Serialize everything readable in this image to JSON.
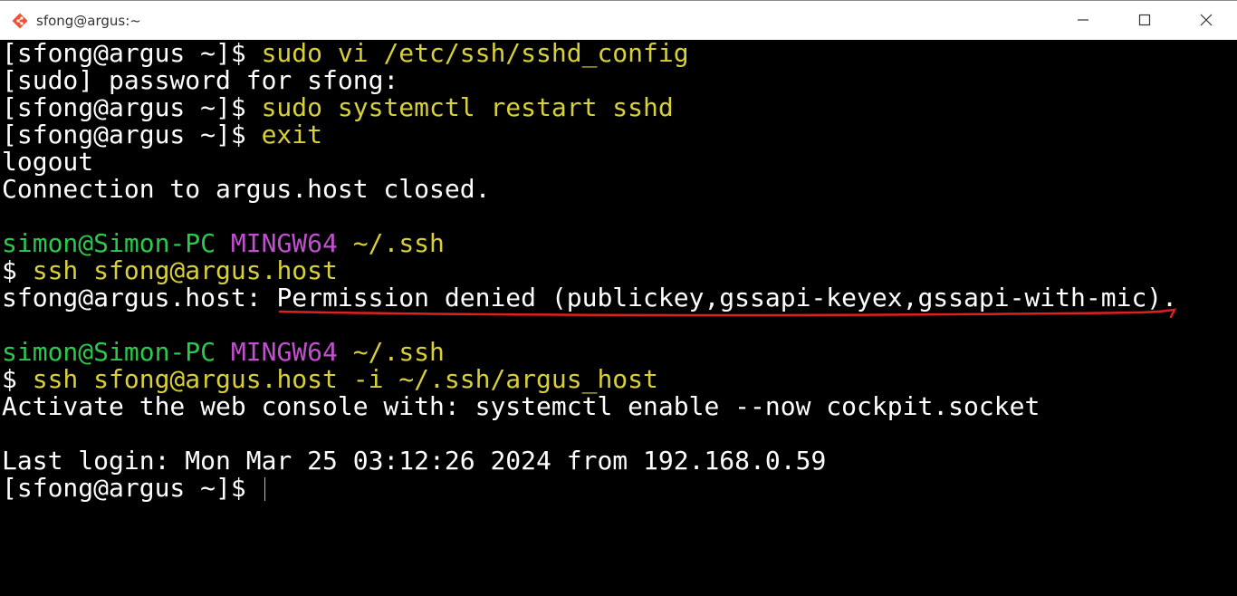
{
  "window": {
    "title": "sfong@argus:~",
    "icon": "git-diamond-icon",
    "controls": {
      "minimize": "minimize-icon",
      "maximize": "maximize-icon",
      "close": "close-icon"
    }
  },
  "colors": {
    "background": "#000000",
    "text": "#ffffff",
    "command": "#d8d03a",
    "user_host": "#2bc94d",
    "mingw": "#c24fd1",
    "annotation": "#e02020"
  },
  "terminal": {
    "l1_prompt": "[sfong@argus ~]$ ",
    "l1_cmd": "sudo vi /etc/ssh/sshd_config",
    "l2": "[sudo] password for sfong:",
    "l3_prompt": "[sfong@argus ~]$ ",
    "l3_cmd": "sudo systemctl restart sshd",
    "l4_prompt": "[sfong@argus ~]$ ",
    "l4_cmd": "exit",
    "l5": "logout",
    "l6": "Connection to argus.host closed.",
    "p1_user": "simon@Simon-PC",
    "p1_env": "MINGW64",
    "p1_path": "~/.ssh",
    "l8_dollar": "$ ",
    "l8_cmd": "ssh sfong@argus.host",
    "l9_prefix": "sfong@argus.host: ",
    "l9_msg": "Permission denied (publickey,gssapi-keyex,gssapi-with-mic).",
    "p2_user": "simon@Simon-PC",
    "p2_env": "MINGW64",
    "p2_path": "~/.ssh",
    "l11_dollar": "$ ",
    "l11_cmd": "ssh sfong@argus.host -i ~/.ssh/argus_host",
    "l12": "Activate the web console with: systemctl enable --now cockpit.socket",
    "l14": "Last login: Mon Mar 25 03:12:26 2024 from 192.168.0.59",
    "l15_prompt": "[sfong@argus ~]$"
  }
}
